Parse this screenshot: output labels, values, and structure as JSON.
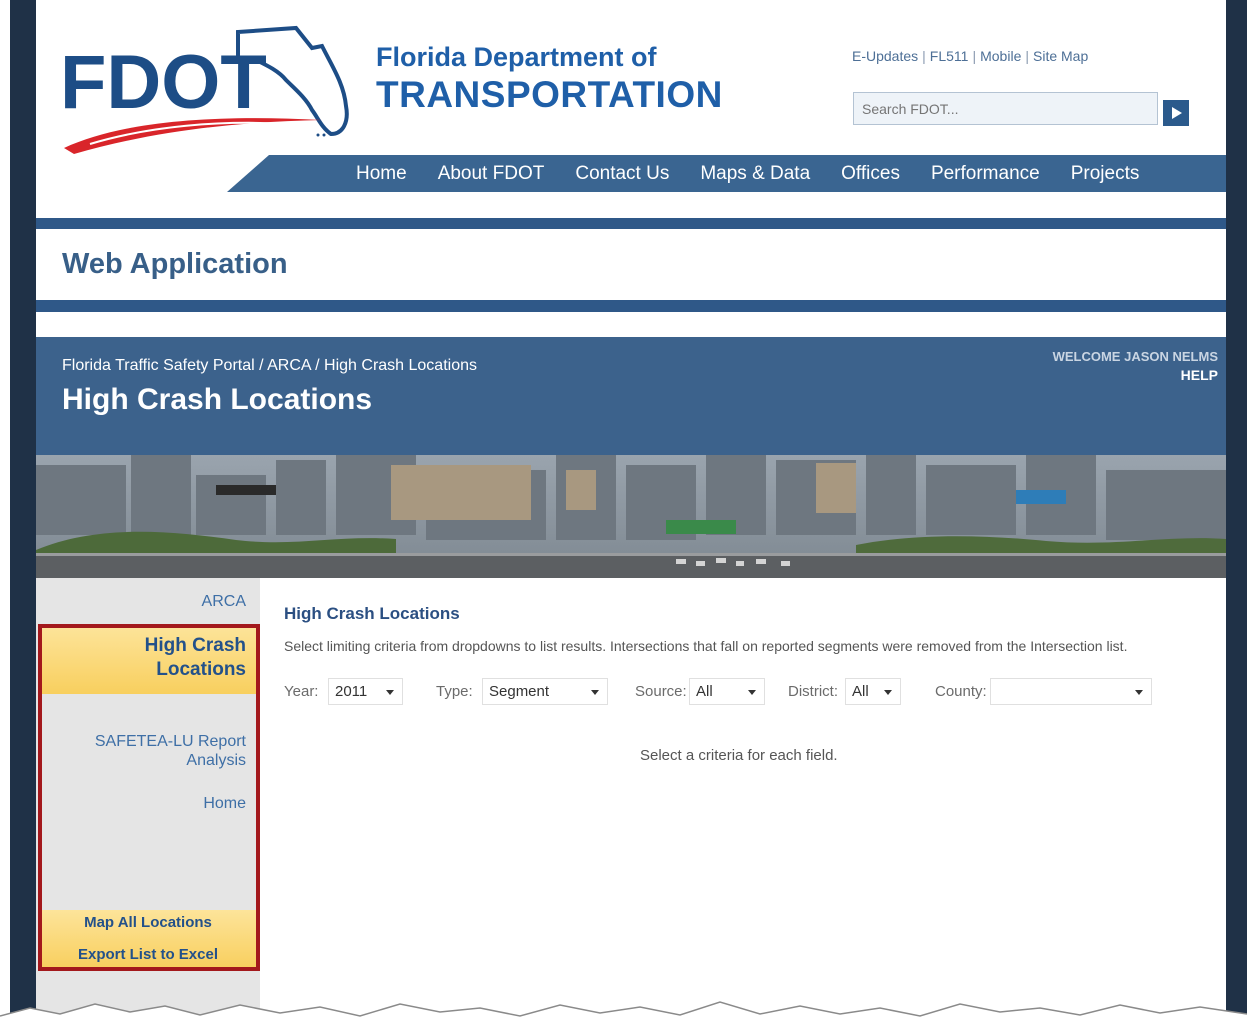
{
  "header": {
    "logo_text": "FDOT",
    "org_line1": "Florida Department of",
    "org_line2": "TRANSPORTATION",
    "util_links": [
      "E-Updates",
      "FL511",
      "Mobile",
      "Site Map"
    ],
    "search_placeholder": "Search FDOT...",
    "nav": [
      "Home",
      "About FDOT",
      "Contact Us",
      "Maps & Data",
      "Offices",
      "Performance",
      "Projects"
    ]
  },
  "section_title": "Web Application",
  "portal": {
    "breadcrumb": "Florida Traffic Safety Portal / ARCA / High Crash Locations",
    "title": "High Crash Locations",
    "welcome": "WELCOME JASON NELMS",
    "help": "HELP"
  },
  "sidebar": {
    "top_link": "ARCA",
    "active_line1": "High Crash",
    "active_line2": "Locations",
    "report_line1": "SAFETEA-LU Report",
    "report_line2": "Analysis",
    "home": "Home",
    "actions": [
      "Map All Locations",
      "Export List to Excel"
    ]
  },
  "main": {
    "title": "High Crash Locations",
    "description": "Select limiting criteria from dropdowns to list results. Intersections that fall on reported segments were removed from the Intersection list.",
    "filters": {
      "year": {
        "label": "Year:",
        "value": "2011"
      },
      "type": {
        "label": "Type:",
        "value": "Segment"
      },
      "source": {
        "label": "Source:",
        "value": "All"
      },
      "district": {
        "label": "District:",
        "value": "All"
      },
      "county": {
        "label": "County:",
        "value": ""
      }
    },
    "empty_message": "Select a criteria for each field."
  },
  "colors": {
    "frame": "#1f3147",
    "brand_blue": "#1f5fa8",
    "nav_blue": "#3a6591",
    "portal_blue": "#3c628c",
    "highlight_yellow": "#f8cf5e",
    "annotation_red": "#a3181c"
  }
}
